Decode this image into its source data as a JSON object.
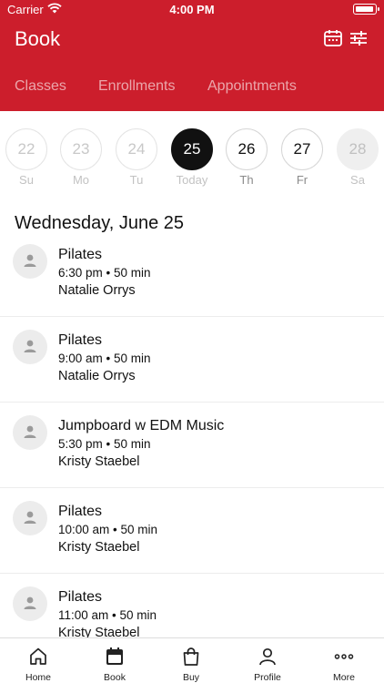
{
  "status_bar": {
    "carrier": "Carrier",
    "time": "4:00 PM",
    "battery_level": 0.95
  },
  "header": {
    "title": "Book",
    "calendar_icon": "calendar-icon",
    "filter_icon": "filter-sliders-icon"
  },
  "tabs": [
    {
      "label": "Classes",
      "active": true
    },
    {
      "label": "Enrollments",
      "active": false
    },
    {
      "label": "Appointments",
      "active": false
    }
  ],
  "days": [
    {
      "number": "22",
      "label": "Su",
      "state": "past"
    },
    {
      "number": "23",
      "label": "Mo",
      "state": "past"
    },
    {
      "number": "24",
      "label": "Tu",
      "state": "past"
    },
    {
      "number": "25",
      "label": "Today",
      "state": "today"
    },
    {
      "number": "26",
      "label": "Th",
      "state": "future"
    },
    {
      "number": "27",
      "label": "Fr",
      "state": "future"
    },
    {
      "number": "28",
      "label": "Sa",
      "state": "disabled"
    }
  ],
  "date_heading": "Wednesday, June 25",
  "classes": [
    {
      "name": "Pilates",
      "time": "6:30 pm • 50 min",
      "instructor": "Natalie Orrys"
    },
    {
      "name": "Pilates",
      "time": "9:00 am • 50 min",
      "instructor": "Natalie Orrys"
    },
    {
      "name": "Jumpboard w EDM Music",
      "time": "5:30 pm • 50 min",
      "instructor": "Kristy Staebel"
    },
    {
      "name": "Pilates",
      "time": "10:00 am • 50 min",
      "instructor": "Kristy Staebel"
    },
    {
      "name": "Pilates",
      "time": "11:00 am • 50 min",
      "instructor": "Kristy Staebel"
    }
  ],
  "tab_bar": [
    {
      "label": "Home",
      "icon": "home-icon"
    },
    {
      "label": "Book",
      "icon": "calendar-icon",
      "active": true
    },
    {
      "label": "Buy",
      "icon": "shopping-bag-icon"
    },
    {
      "label": "Profile",
      "icon": "person-icon"
    },
    {
      "label": "More",
      "icon": "more-dots-icon"
    }
  ],
  "colors": {
    "brand_red": "#cc1e2c",
    "today_circle": "#111111"
  }
}
